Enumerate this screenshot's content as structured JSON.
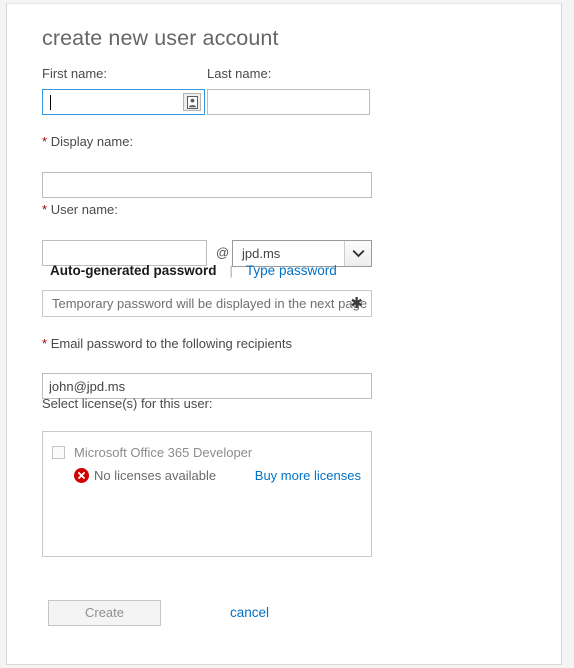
{
  "dialog": {
    "title": "create new user account"
  },
  "form": {
    "first_name": {
      "label": "First name:",
      "value": "",
      "placeholder": "",
      "ime_icon": "contact-card-icon"
    },
    "last_name": {
      "label": "Last name:",
      "value": "",
      "placeholder": ""
    },
    "display_name": {
      "required_mark": "*",
      "label": "Display name:",
      "value": "",
      "placeholder": ""
    },
    "user_name": {
      "required_mark": "*",
      "label": "User name:",
      "value": "",
      "placeholder": "",
      "at_symbol": "@",
      "domain_selected": "jpd.ms",
      "domain_options": [
        "jpd.ms"
      ],
      "chevron_icon": "chevron-down-icon"
    },
    "password": {
      "auto_tab_label": "Auto-generated password",
      "divider": "|",
      "type_tab_label": "Type password",
      "auto_field_text": "Temporary password will be displayed in the next page",
      "asterisk_icon": "asterisk-icon"
    },
    "email_recipients": {
      "required_mark": "*",
      "label": "Email password to the following recipients",
      "value": "john@jpd.ms",
      "placeholder": ""
    },
    "licenses": {
      "label": "Select license(s) for this user:",
      "items": [
        {
          "name": "Microsoft Office 365 Developer",
          "checked": false,
          "error_icon": "error-circle-icon",
          "error_text": "No licenses available",
          "buy_link": "Buy more licenses"
        }
      ]
    }
  },
  "footer": {
    "create_label": "Create",
    "cancel_label": "cancel"
  },
  "colors": {
    "link_blue": "#0072C6",
    "focus_blue": "#3A96DD",
    "required_red": "#A80000",
    "error_red": "#D30000",
    "title_gray": "#666666"
  }
}
